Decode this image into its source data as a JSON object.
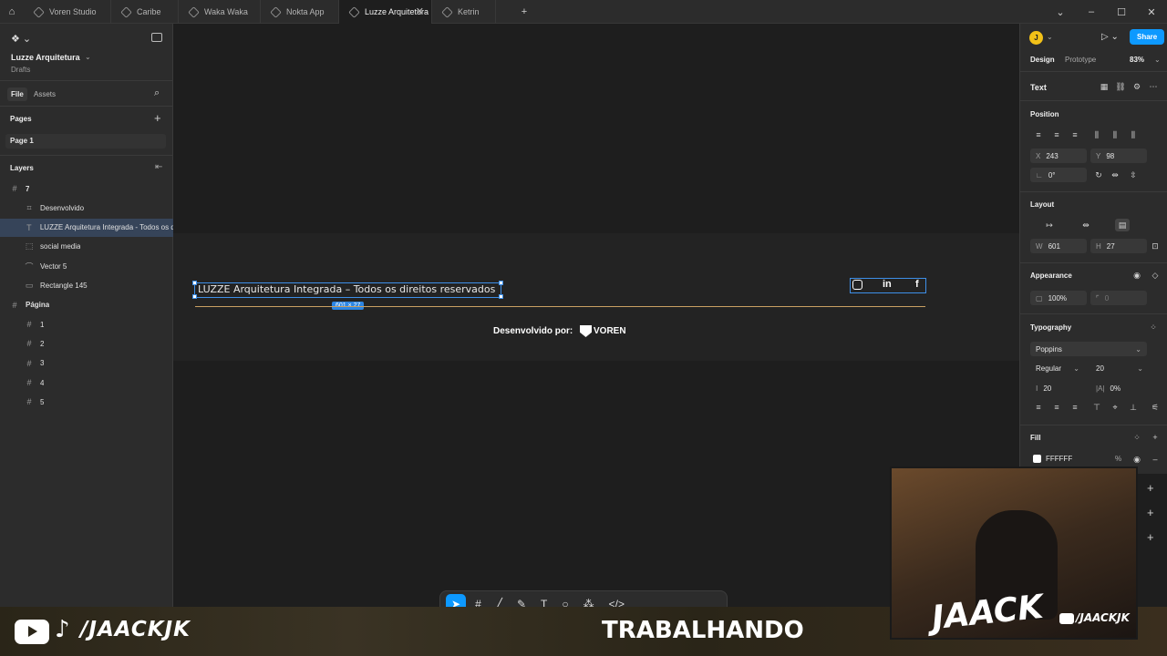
{
  "tabs": [
    {
      "label": "Voren Studio"
    },
    {
      "label": "Caribe"
    },
    {
      "label": "Waka Waka"
    },
    {
      "label": "Nokta App"
    },
    {
      "label": "Luzze Arquitetura",
      "active": true
    },
    {
      "label": "Ketrin"
    }
  ],
  "tab_add": "+",
  "file": {
    "name": "Luzze Arquitetura",
    "location": "Drafts"
  },
  "left_tabs": {
    "file": "File",
    "assets": "Assets"
  },
  "pages": {
    "title": "Pages",
    "items": [
      "Page 1"
    ]
  },
  "layers": {
    "title": "Layers",
    "items": [
      {
        "label": "7",
        "glyph": "#",
        "indent": 0,
        "bold": true
      },
      {
        "label": "Desenvolvido",
        "glyph": "⌗",
        "indent": 1
      },
      {
        "label": "LUZZE Arquitetura Integrada - Todos os d",
        "glyph": "T",
        "indent": 1,
        "selected": true
      },
      {
        "label": "social media",
        "glyph": "⬚",
        "indent": 1
      },
      {
        "label": "Vector 5",
        "glyph": "⌒",
        "indent": 1
      },
      {
        "label": "Rectangle 145",
        "glyph": "▭",
        "indent": 1
      },
      {
        "label": "Página",
        "glyph": "#",
        "indent": 0,
        "bold": true
      },
      {
        "label": "1",
        "glyph": "#",
        "indent": 1
      },
      {
        "label": "2",
        "glyph": "#",
        "indent": 1
      },
      {
        "label": "3",
        "glyph": "#",
        "indent": 1
      },
      {
        "label": "4",
        "glyph": "#",
        "indent": 1
      },
      {
        "label": "5",
        "glyph": "#",
        "indent": 1
      }
    ]
  },
  "canvas": {
    "footer_text": "LUZZE Arquitetura Integrada – Todos os direitos reservados",
    "size_badge": "601 × 27",
    "credit": "Desenvolvido por:",
    "brand": "VOREN",
    "line_color": "#c9a063"
  },
  "right": {
    "avatar": "J",
    "share": "Share",
    "tabs": {
      "design": "Design",
      "prototype": "Prototype"
    },
    "zoom": "83%",
    "section": "Text",
    "position": {
      "title": "Position",
      "x_label": "X",
      "x": "243",
      "y_label": "Y",
      "y": "98",
      "rot": "0°"
    },
    "layout": {
      "title": "Layout",
      "w_label": "W",
      "w": "601",
      "h_label": "H",
      "h": "27"
    },
    "appearance": {
      "title": "Appearance",
      "opacity": "100%",
      "radius": "0"
    },
    "typography": {
      "title": "Typography",
      "font": "Poppins",
      "weight": "Regular",
      "size": "20",
      "line_height": "20",
      "letter_spacing": "0%"
    },
    "fill": {
      "title": "Fill",
      "hex": "FFFFFF",
      "opacity": "%"
    }
  },
  "stream": {
    "handle": "/JAACKJK",
    "center": "TRABALHANDO",
    "logo": "JAACK",
    "handle_small": "/JAACKJK"
  }
}
